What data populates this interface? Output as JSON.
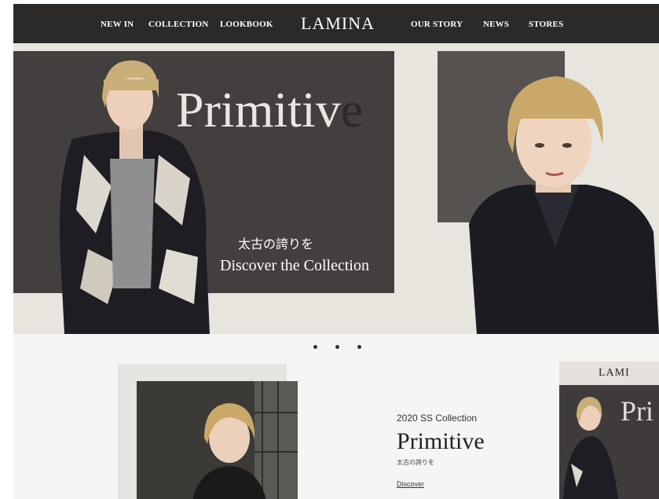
{
  "nav": {
    "left_items": [
      "NEW IN",
      "COLLECTION",
      "LOOKBOOK"
    ],
    "logo": "LAMINA",
    "right_items": [
      "OUR STORY",
      "NEWS",
      "STORES"
    ]
  },
  "hero": {
    "title_main": "Primitiv",
    "title_tail": "e",
    "tagline_jp": "太古の誇りを",
    "cta": "Discover the Collection"
  },
  "carousel": {
    "dot_count": 3,
    "active_index": 0
  },
  "feature": {
    "subtitle": "2020 SS Collection",
    "title": "Primitive",
    "tagline_jp": "太古の誇りを",
    "link": "Discover"
  },
  "preview": {
    "logo": "LAMI",
    "title": "Pri"
  },
  "colors": {
    "nav_bg": "#2c2a29",
    "hero_bg": "#e8e4de",
    "panel_dark": "#433f3e"
  }
}
